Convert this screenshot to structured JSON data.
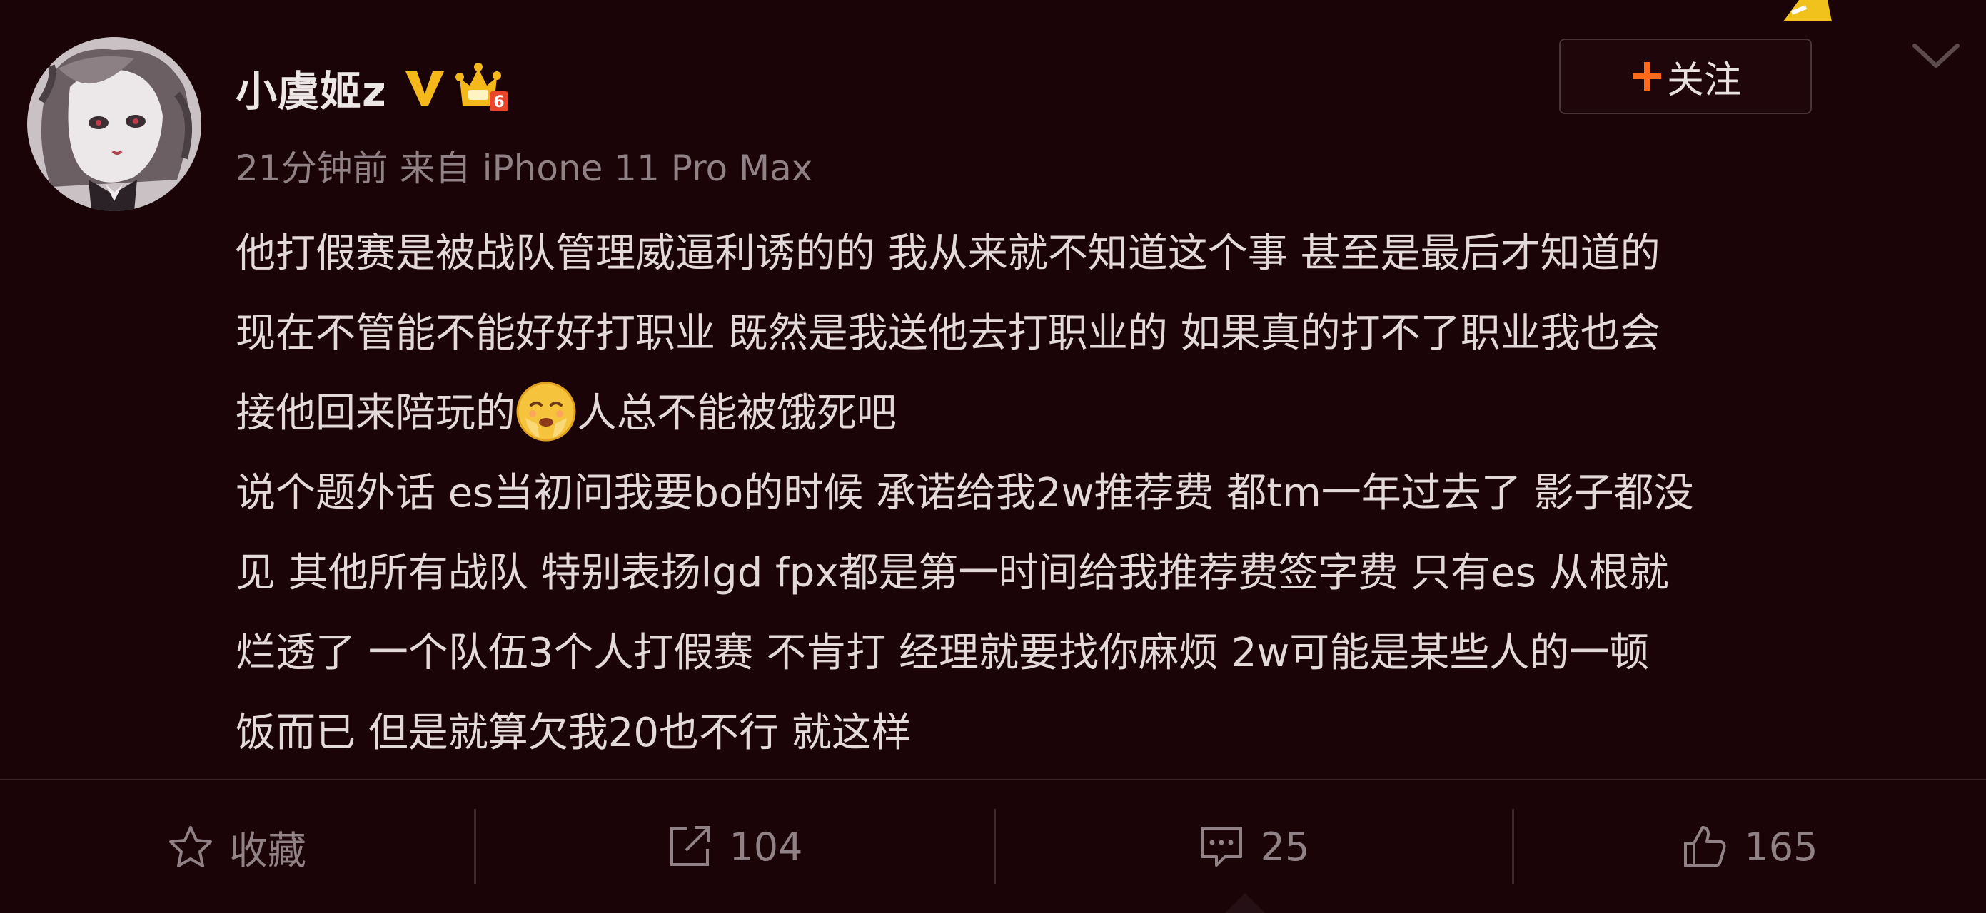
{
  "post": {
    "username": "小虞姬z",
    "time": "21分钟前",
    "source_prefix": "来自",
    "device": "iPhone 11 Pro Max",
    "follow_label": "关注",
    "lines": [
      "他打假赛是被战队管理威逼利诱的的 我从来就不知道这个事 甚至是最后才知道的",
      "现在不管能不能好好打职业 既然是我送他去打职业的 如果真的打不了职业我也会",
      "接他回来陪玩的",
      "人总不能被饿死吧",
      "说个题外话 es当初问我要bo的时候 承诺给我2w推荐费 都tm一年过去了 影子都没",
      "见 其他所有战队 特别表扬lgd fpx都是第一时间给我推荐费签字费 只有es 从根就",
      "烂透了  一个队伍3个人打假赛 不肯打 经理就要找你麻烦 2w可能是某些人的一顿",
      "饭而已 但是就算欠我20也不行 就这样"
    ]
  },
  "footer": {
    "favorite_label": "收藏",
    "repost_count": "104",
    "comment_count": "25",
    "like_count": "165"
  },
  "icons": {
    "verified": "verified-v-icon",
    "member": "crown-member-icon",
    "follow": "plus-icon",
    "menu": "chevron-down-icon",
    "favorite": "star-icon",
    "repost": "repost-icon",
    "comment": "comment-icon",
    "like": "thumbs-up-icon",
    "emoji": "crying-face-emoji"
  },
  "colors": {
    "background": "#1b0408",
    "text": "#e3d9db",
    "muted": "#8f8185",
    "accent_orange": "#ff6a1a",
    "verified_gold": "#f5b81a"
  }
}
